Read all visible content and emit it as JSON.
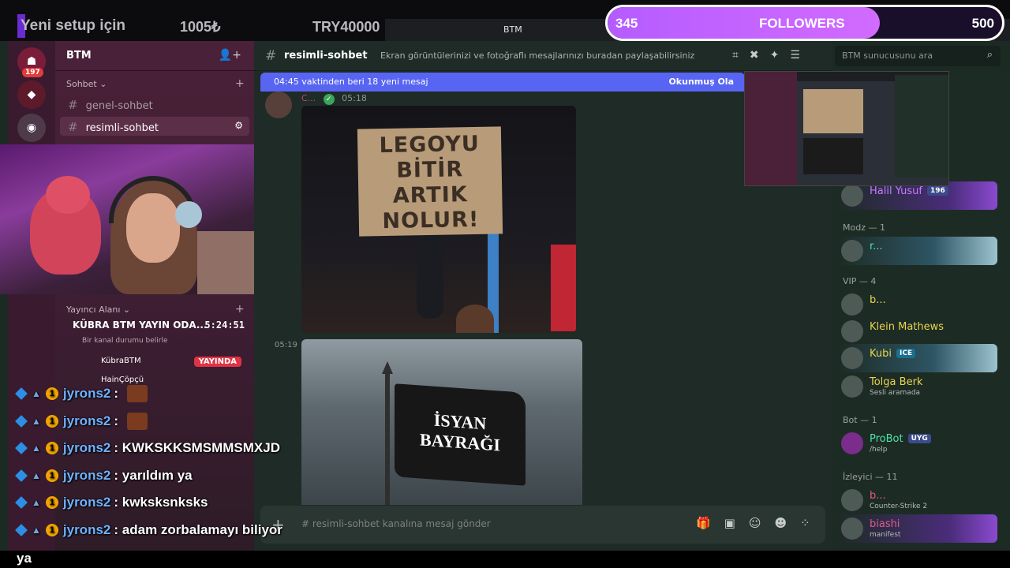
{
  "stream": {
    "ticker1": "Yeni setup için",
    "ticker2": "1005₺",
    "ticker3": "TRY40000",
    "window_title": "BTM",
    "followers": {
      "current": "345",
      "label": "FOLLOWERS",
      "goal": "500",
      "progress": 0.69
    },
    "caption_tail": "ya"
  },
  "server": {
    "name": "BTM",
    "badge_count": "197",
    "categories": [
      {
        "label": "Sohbet",
        "channels": [
          {
            "label": "genel-sohbet"
          },
          {
            "label": "resimli-sohbet"
          }
        ]
      },
      {
        "label": "Yayıncı Alanı"
      }
    ],
    "voice": {
      "channel": "KÜBRA BTM YAYIN ODA...",
      "timer": "5:24:51",
      "status_hint": "Bir kanal durumu belirle",
      "user1": "KübraBTM",
      "user1_badge": "YAYINDA",
      "user2": "HainÇöpçü"
    }
  },
  "chat_overlay": [
    {
      "user": "jyrons2",
      "msg": ""
    },
    {
      "user": "jyrons2",
      "msg": ""
    },
    {
      "user": "jyrons2",
      "msg": "KWKSKKSMSMMSMXJD"
    },
    {
      "user": "jyrons2",
      "msg": "yarıldım ya"
    },
    {
      "user": "jyrons2",
      "msg": "kwksksnksks"
    },
    {
      "user": "jyrons2",
      "msg": "adam zorbalamayı biliyor"
    }
  ],
  "channel": {
    "name": "resimli-sohbet",
    "topic": "Ekran görüntülerinizi ve fotoğraflı mesajlarınızı buradan paylaşabilirsiniz",
    "search_placeholder": "BTM sunucusunu ara",
    "new_messages": "04:45 vaktinden beri 18 yeni mesaj",
    "mark_read": "Okunmuş Ola",
    "message_author": "C...",
    "time1": "05:18",
    "time2": "05:19",
    "image1_text": "LEGOYU BİTİR ARTIK NOLUR!",
    "image2_text": "İSYAN BAYRAĞI",
    "input_placeholder": "# resimli-sohbet kanalına mesaj gönder"
  },
  "members": {
    "top_user": {
      "name": "Halil Yusuf",
      "tag": "196"
    },
    "groups": [
      {
        "label": "Modz — 1",
        "users": [
          {
            "name": "r...",
            "sub": ""
          }
        ]
      },
      {
        "label": "VIP — 4",
        "users": [
          {
            "name": "b...",
            "sub": ""
          },
          {
            "name": "Klein Mathews",
            "sub": ""
          },
          {
            "name": "Kubi",
            "sub": "",
            "tag": "ICE"
          },
          {
            "name": "Tolga Berk",
            "sub": "Sesli aramada"
          }
        ]
      },
      {
        "label": "Bot — 1",
        "users": [
          {
            "name": "ProBot",
            "sub": "/help",
            "tag": "UYG"
          }
        ]
      },
      {
        "label": "İzleyici — 11",
        "users": [
          {
            "name": "b...",
            "sub": "Counter-Strike 2"
          },
          {
            "name": "biashi",
            "sub": "manifest"
          }
        ]
      }
    ]
  },
  "icons": [
    "server-icon",
    "hash-icon",
    "plus-icon",
    "search-icon",
    "gear-icon",
    "gift-icon",
    "gif-icon",
    "emoji-icon",
    "pin-icon",
    "members-icon",
    "mute-icon"
  ]
}
